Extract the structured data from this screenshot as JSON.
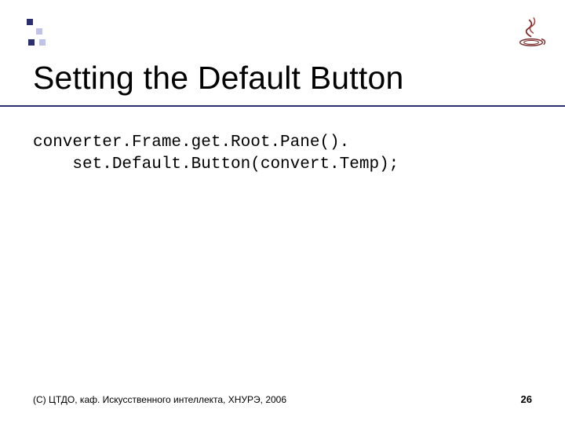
{
  "title": "Setting the Default Button",
  "code": {
    "line1": "converter.Frame.get.Root.Pane().",
    "line2": "    set.Default.Button(convert.Temp);"
  },
  "footer": {
    "copyright": "(С) ЦТДО, каф. Искусственного интеллекта, ХНУРЭ, 2006",
    "page": "26"
  },
  "icon": {
    "name": "java-logo"
  }
}
